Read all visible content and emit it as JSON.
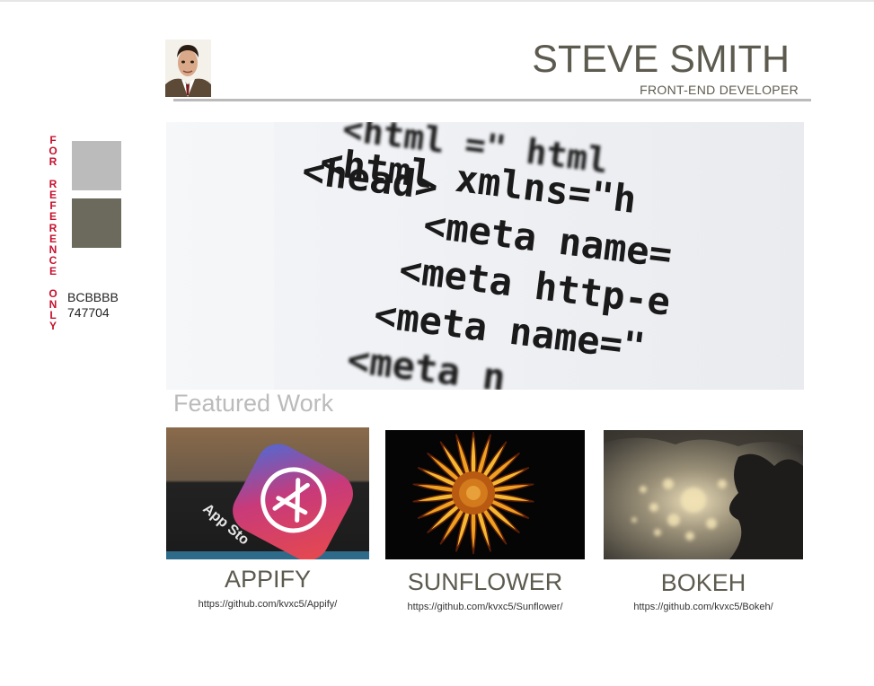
{
  "reference": {
    "label_chars": [
      "F",
      "O",
      "R",
      " ",
      "R",
      "E",
      "F",
      "E",
      "R",
      "E",
      "N",
      "C",
      "E",
      " ",
      "O",
      "N",
      "L",
      "Y"
    ],
    "swatch_colors": [
      "#BCBBBB",
      "#747704"
    ],
    "swatch_render_colors": [
      "#bcbbbb",
      "#6b6a5c"
    ],
    "hex_codes": [
      "BCBBBB",
      "747704"
    ]
  },
  "header": {
    "name": "STEVE SMITH",
    "role": "FRONT-END DEVELOPER",
    "avatar_icon": "profile-photo"
  },
  "hero": {
    "code_lines": [
      "<html xmlns=\"h",
      "<head>",
      "<meta name=",
      "<meta http-e",
      "<meta name=\"",
      "<meta n"
    ],
    "top_fragment": "<html        =\"  html"
  },
  "featured": {
    "heading": "Featured Work",
    "cards": [
      {
        "title": "APPIFY",
        "link": "https://github.com/kvxc5/Appify/",
        "image_text": "App Sto"
      },
      {
        "title": "SUNFLOWER",
        "link": "https://github.com/kvxc5/Sunflower/"
      },
      {
        "title": "BOKEH",
        "link": "https://github.com/kvxc5/Bokeh/"
      }
    ]
  }
}
